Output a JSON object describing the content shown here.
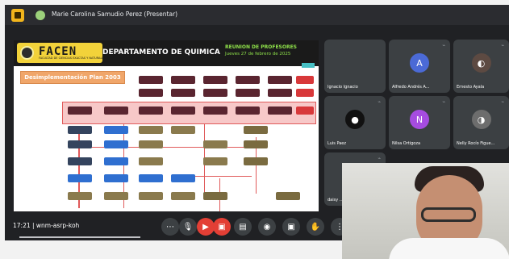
{
  "meeting": {
    "presenter_text": "Marie Carolina Samudio Perez (Presentar)",
    "time_code": "17:21 | wnm-asrp-koh"
  },
  "slide": {
    "logo_text": "FACEN",
    "logo_subtitle": "FACULTAD DE CIENCIAS EXACTAS Y NATURALES",
    "department": "DEPARTAMENTO DE QUIMICA",
    "meeting_title": "REUNION DE PROFESORES",
    "meeting_date": "Jueves 27 de febrero de 2025",
    "plan_button": "Desimplementación Plan 2003"
  },
  "participants": [
    {
      "name": "Ignacio Ignacio",
      "avatar": "",
      "color": "#4a4f54"
    },
    {
      "name": "Alfredo Andrés A...",
      "avatar": "A",
      "color": "#4b6ad6"
    },
    {
      "name": "Ernesto Ayala",
      "avatar": "",
      "color": "#5d4a42"
    },
    {
      "name": "Luis Paez",
      "avatar": "",
      "color": "#111"
    },
    {
      "name": "Nilsa Ortigoza",
      "avatar": "N",
      "color": "#a64ce0"
    },
    {
      "name": "Nelly Rocío Figue...",
      "avatar": "",
      "color": "#6d6d6d"
    },
    {
      "name": "daisy ...",
      "avatar": "",
      "color": "#4a4f54"
    }
  ],
  "colors": {
    "background": "#202124",
    "tile": "#3c4043",
    "accent": "#f2b51c",
    "danger": "#e33f35",
    "green": "#8fe24a"
  }
}
